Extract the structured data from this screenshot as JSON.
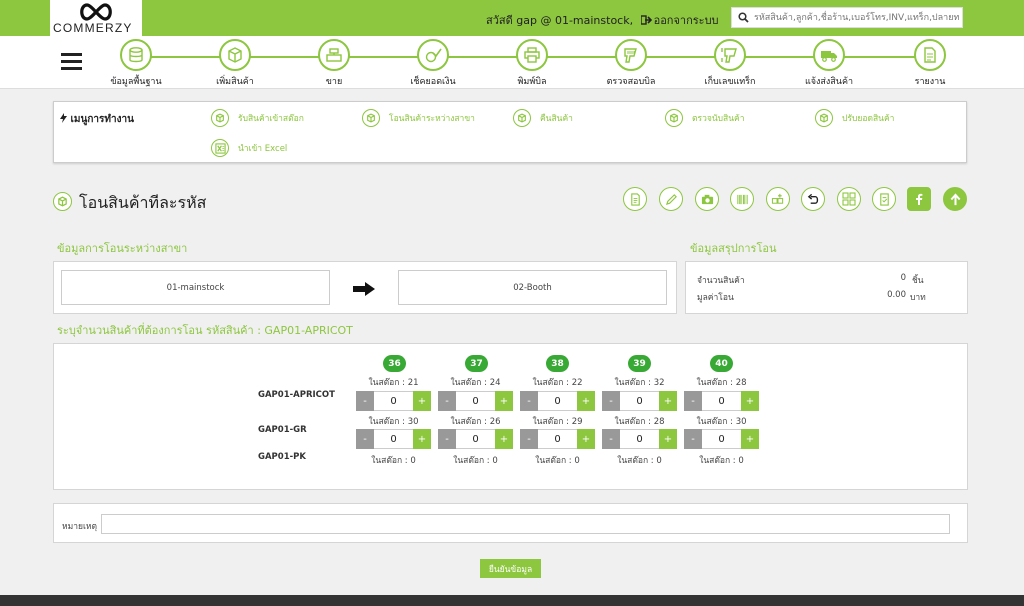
{
  "brand": {
    "name": "COMMERZY",
    "accent": "#8dc63f",
    "dark_green": "#39a935"
  },
  "header": {
    "greeting": "สวัสดี gap @ 01-mainstock,",
    "logout_label": "ออกจากระบบ",
    "search_placeholder": "รหัสสินค้า,ลูกค้า,ชื่อร้าน,เบอร์โทร,INV,แทร็ก,ปลายทาง"
  },
  "nav": {
    "items": [
      {
        "label": "ข้อมูลพื้นฐาน",
        "icon": "database-icon"
      },
      {
        "label": "เพิ่มสินค้า",
        "icon": "box-icon"
      },
      {
        "label": "ขาย",
        "icon": "cash-register-icon"
      },
      {
        "label": "เช็คยอดเงิน",
        "icon": "check-money-icon"
      },
      {
        "label": "พิมพ์บิล",
        "icon": "printer-icon"
      },
      {
        "label": "ตรวจสอบบิล",
        "icon": "scanner-icon"
      },
      {
        "label": "เก็บเลขแทร็ก",
        "icon": "barcode-scanner-icon"
      },
      {
        "label": "แจ้งส่งสินค้า",
        "icon": "truck-icon"
      },
      {
        "label": "รายงาน",
        "icon": "report-icon"
      }
    ]
  },
  "work_menu": {
    "title": "เมนูการทำงาน",
    "items": [
      {
        "label": "รับสินค้าเข้าสต๊อก",
        "icon": "box-icon"
      },
      {
        "label": "โอนสินค้าระหว่างสาขา",
        "icon": "box-icon"
      },
      {
        "label": "คืนสินค้า",
        "icon": "box-icon"
      },
      {
        "label": "ตรวจนับสินค้า",
        "icon": "box-icon"
      },
      {
        "label": "ปรับยอดสินค้า",
        "icon": "box-icon"
      },
      {
        "label": "นำเข้า Excel",
        "icon": "excel-icon"
      }
    ]
  },
  "page": {
    "title": "โอนสินค้าทีละรหัส",
    "transfer_section_title": "ข้อมูลการโอนระหว่างสาขา",
    "summary_section_title": "ข้อมูลสรุปการโอน",
    "from_branch": "01-mainstock",
    "to_branch": "02-Booth",
    "summary": {
      "qty_label": "จำนวนสินค้า",
      "qty_value": "0",
      "qty_unit": "ชิ้น",
      "value_label": "มูลค่าโอน",
      "value_value": "0.00",
      "value_unit": "บาท"
    },
    "matrix_title": "ระบุจำนวนสินค้าที่ต้องการโอน รหัสสินค้า : GAP01-APRICOT",
    "stock_prefix": "ในสต๊อก : ",
    "minus": "-",
    "plus": "+",
    "sizes": [
      "36",
      "37",
      "38",
      "39",
      "40"
    ],
    "rows": [
      {
        "name": "GAP01-APRICOT",
        "stock": [
          "21",
          "24",
          "22",
          "32",
          "28"
        ],
        "qty": [
          "0",
          "0",
          "0",
          "0",
          "0"
        ]
      },
      {
        "name": "GAP01-GR",
        "stock": [
          "30",
          "26",
          "29",
          "28",
          "30"
        ],
        "qty": [
          "0",
          "0",
          "0",
          "0",
          "0"
        ]
      },
      {
        "name": "GAP01-PK",
        "stock": [
          "0",
          "0",
          "0",
          "0",
          "0"
        ]
      }
    ],
    "note_label": "หมายเหตุ",
    "note_value": "",
    "confirm_label": "ยืนยันข้อมูล"
  },
  "toolbar_icons": [
    "document-icon",
    "pencil-icon",
    "camera-icon",
    "barcode-icon",
    "add-product-icon",
    "undo-icon",
    "grid-icon",
    "checklist-icon",
    "facebook-icon",
    "upload-arrow-icon"
  ]
}
